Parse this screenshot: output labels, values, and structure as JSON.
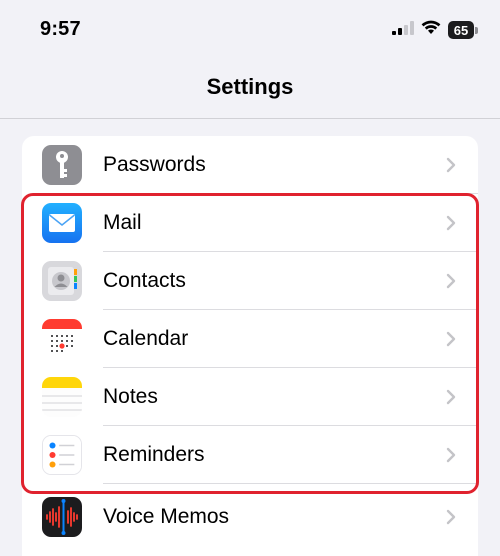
{
  "status_bar": {
    "time": "9:57",
    "battery_level": "65",
    "signal_icon": "cellular-signal-icon",
    "wifi_icon": "wifi-icon"
  },
  "nav": {
    "title": "Settings"
  },
  "settings_rows": [
    {
      "label": "Passwords",
      "icon": "key-icon",
      "icon_color": "#8e8e93"
    },
    {
      "label": "Mail",
      "icon": "envelope-icon",
      "icon_color": "#1a8cff"
    },
    {
      "label": "Contacts",
      "icon": "contact-card-icon",
      "icon_color": "#c7c7cc"
    },
    {
      "label": "Calendar",
      "icon": "calendar-icon",
      "icon_color": "#ff3b30"
    },
    {
      "label": "Notes",
      "icon": "notes-icon",
      "icon_color": "#ffd60a"
    },
    {
      "label": "Reminders",
      "icon": "reminders-icon",
      "icon_color": "#ffffff"
    },
    {
      "label": "Voice Memos",
      "icon": "waveform-icon",
      "icon_color": "#1c1c1e"
    }
  ],
  "highlight_color": "#e0222e"
}
